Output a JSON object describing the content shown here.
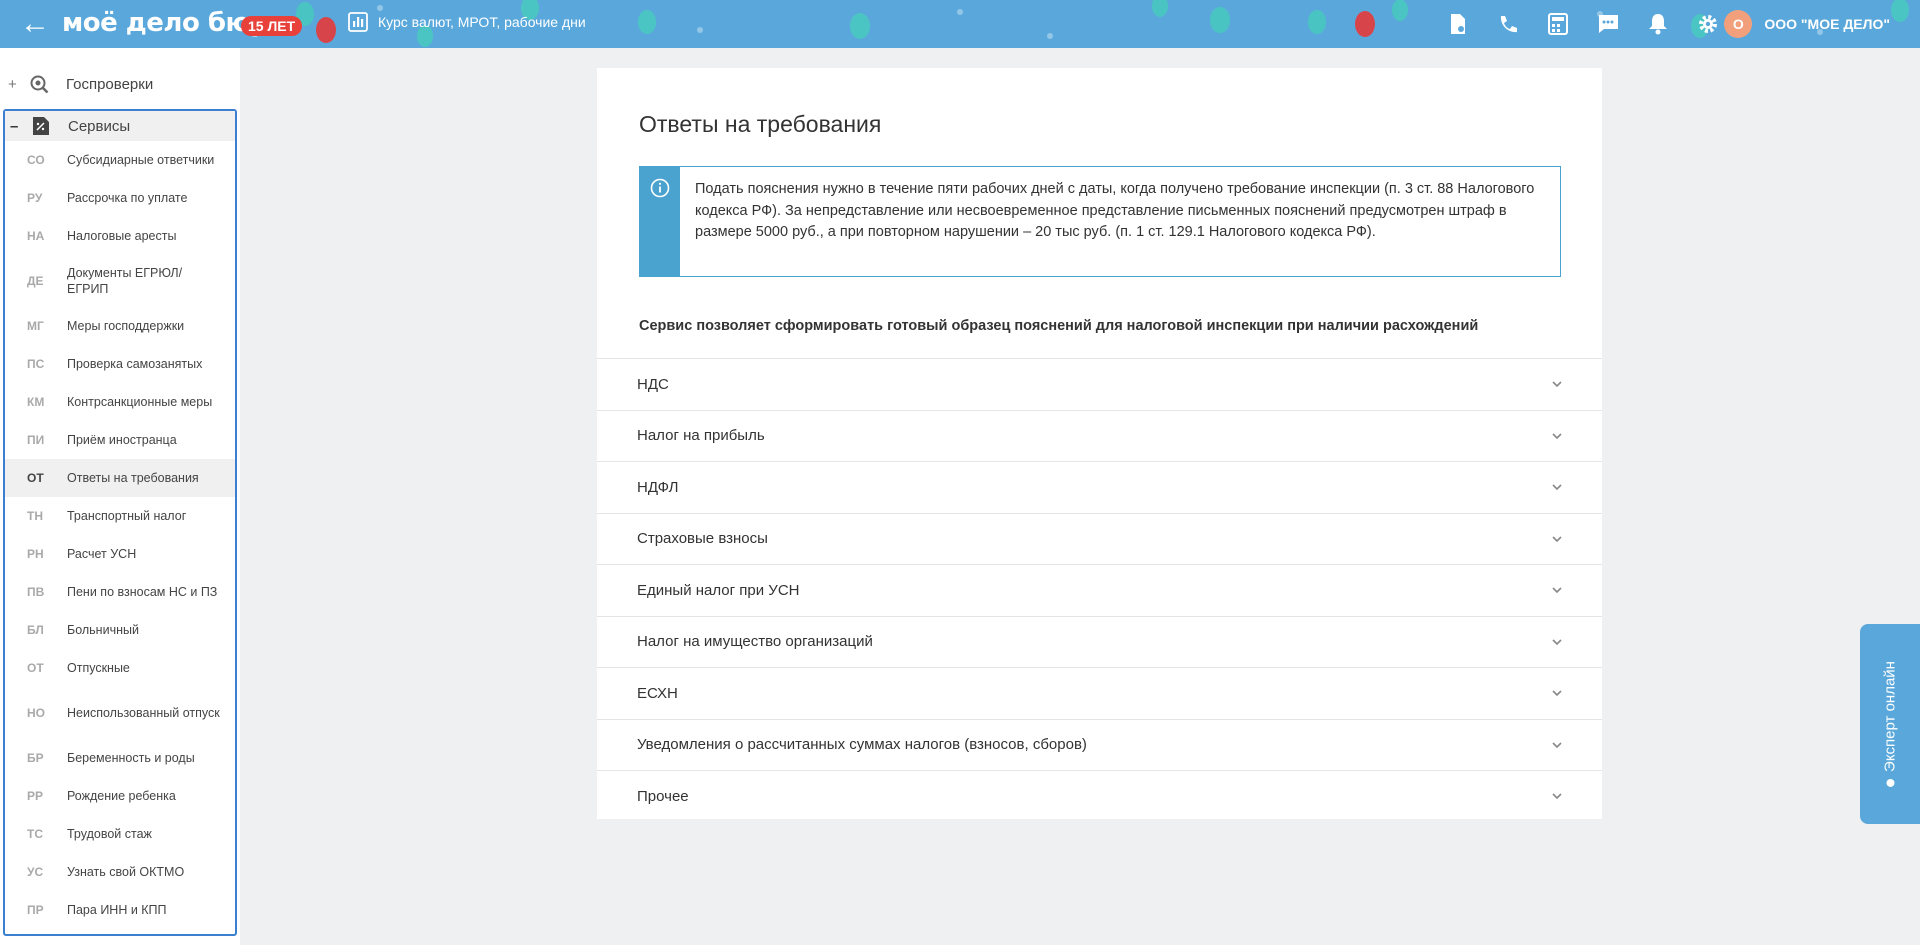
{
  "header": {
    "logo": "моё дело бюро",
    "years_badge": "15 ЛЕТ",
    "rates_link": "Курс валют, МРОТ, рабочие дни",
    "org_avatar": "О",
    "org_name": "ООО \"МОЕ ДЕЛО\"",
    "icons": [
      "back-arrow-icon",
      "chart-icon",
      "document-icon",
      "phone-icon",
      "calculator-icon",
      "chat-icon",
      "bell-icon",
      "gear-icon"
    ],
    "colors": {
      "background": "#5aa8db",
      "badge": "#e8413a",
      "avatar": "#f2a07b"
    }
  },
  "sidebar": {
    "group_gosprov": {
      "toggle": "+",
      "label": "Госпроверки"
    },
    "group_services": {
      "toggle": "–",
      "label": "Сервисы"
    },
    "items": [
      {
        "abbr": "СО",
        "label": "Субсидиарные ответчики"
      },
      {
        "abbr": "РУ",
        "label": "Рассрочка по уплате"
      },
      {
        "abbr": "НА",
        "label": "Налоговые аресты"
      },
      {
        "abbr": "ДЕ",
        "label": "Документы ЕГРЮЛ/ ЕГРИП"
      },
      {
        "abbr": "МГ",
        "label": "Меры господдержки"
      },
      {
        "abbr": "ПС",
        "label": "Проверка самозанятых"
      },
      {
        "abbr": "КМ",
        "label": "Контрсанкционные меры"
      },
      {
        "abbr": "ПИ",
        "label": "Приём иностранца"
      },
      {
        "abbr": "ОТ",
        "label": "Ответы на требования"
      },
      {
        "abbr": "ТН",
        "label": "Транспортный налог"
      },
      {
        "abbr": "РН",
        "label": "Расчет УСН"
      },
      {
        "abbr": "ПВ",
        "label": "Пени по взносам НС и ПЗ"
      },
      {
        "abbr": "БЛ",
        "label": "Больничный"
      },
      {
        "abbr": "ОТ",
        "label": "Отпускные"
      },
      {
        "abbr": "НО",
        "label": "Неиспользованный отпуск"
      },
      {
        "abbr": "БР",
        "label": "Беременность и роды"
      },
      {
        "abbr": "РР",
        "label": "Рождение ребенка"
      },
      {
        "abbr": "ТС",
        "label": "Трудовой стаж"
      },
      {
        "abbr": "УС",
        "label": "Узнать свой ОКТМО"
      },
      {
        "abbr": "ПР",
        "label": "Пара ИНН и КПП"
      }
    ],
    "active_item": "Ответы на требования"
  },
  "main": {
    "title": "Ответы на требования",
    "info_text": "Подать пояснения нужно в течение пяти рабочих дней с даты, когда получено требование инспекции (п. 3 ст. 88 Налогового кодекса РФ). За непредставление или несвоевременное представление письменных пояснений предусмотрен штраф в размере 5000 руб., а при повторном нарушении – 20 тыс руб. (п. 1 ст. 129.1 Налогового кодекса РФ).",
    "subtitle": "Сервис позволяет сформировать готовый образец пояснений для налоговой инспекции при наличии расхождений",
    "accordion": [
      "НДС",
      "Налог на прибыль",
      "НДФЛ",
      "Страховые взносы",
      "Единый налог при УСН",
      "Налог на имущество организаций",
      "ЕСХН",
      "Уведомления о рассчитанных суммах налогов (взносов, сборов)",
      "Прочее"
    ],
    "info_accent": "#4aa2cf"
  },
  "expert_tab": {
    "label": "Эксперт онлайн"
  }
}
